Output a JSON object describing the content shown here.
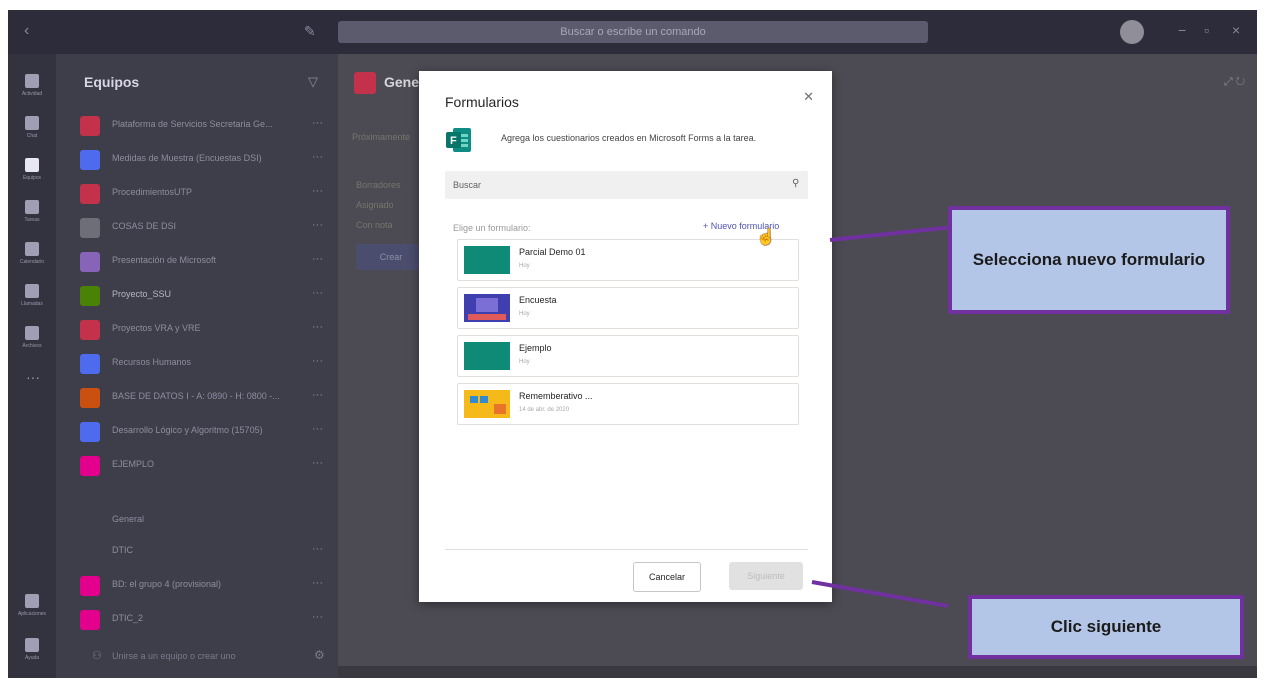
{
  "titlebar": {
    "search_placeholder": "Buscar o escribe un comando"
  },
  "rail": {
    "items": [
      {
        "label": "Actividad",
        "icon": "bell-icon"
      },
      {
        "label": "Chat",
        "icon": "chat-icon"
      },
      {
        "label": "Equipos",
        "icon": "teams-icon"
      },
      {
        "label": "Tareas",
        "icon": "assignments-icon"
      },
      {
        "label": "Calendario",
        "icon": "calendar-icon"
      },
      {
        "label": "Llamadas",
        "icon": "phone-icon"
      },
      {
        "label": "Archivos",
        "icon": "files-icon"
      }
    ],
    "bottom": [
      {
        "label": "Aplicaciones",
        "icon": "apps-icon"
      },
      {
        "label": "Ayuda",
        "icon": "help-icon"
      }
    ]
  },
  "teams_list": {
    "header": "Equipos",
    "teams": [
      {
        "name": "Plataforma de Servicios Secretaria Ge...",
        "color": "#c4314b"
      },
      {
        "name": "Medidas de Muestra (Encuestas DSI)",
        "color": "#4f6bed"
      },
      {
        "name": "ProcedimientosUTP",
        "color": "#c4314b"
      },
      {
        "name": "COSAS DE DSI",
        "color": "#6e6e78"
      },
      {
        "name": "Presentación de Microsoft",
        "color": "#8764b8"
      },
      {
        "name": "Proyecto_SSU",
        "color": "#498205"
      },
      {
        "name": "Proyectos VRA y VRE",
        "color": "#c4314b"
      },
      {
        "name": "Recursos Humanos",
        "color": "#4f6bed"
      },
      {
        "name": "BASE DE DATOS I - A: 0890 - H: 0800 -...",
        "color": "#ca5010"
      },
      {
        "name": "Desarrollo Lógico y Algoritmo (15705)",
        "color": "#4f6bed"
      },
      {
        "name": "EJEMPLO",
        "color": "#e3008c"
      },
      {
        "name": "DTIC",
        "color": ""
      },
      {
        "name": "BD: el grupo 4 (provisional)",
        "color": "#e3008c"
      },
      {
        "name": "DTIC_2",
        "color": "#e3008c"
      }
    ],
    "channel": "General",
    "join_label": "Unirse a un equipo o crear uno"
  },
  "main": {
    "channel_title": "General",
    "tab_label": "Próximamente",
    "assignment_sections": [
      "Borradores",
      "Asignado",
      "Con nota"
    ],
    "create_button": "Crear"
  },
  "modal": {
    "title": "Formularios",
    "description": "Agrega los cuestionarios creados en Microsoft Forms a la tarea.",
    "search_placeholder": "Buscar",
    "choose_label": "Elige un formulario:",
    "new_form_label": "+ Nuevo formulario",
    "forms": [
      {
        "name": "Parcial Demo 01",
        "date": "Hoy"
      },
      {
        "name": "Encuesta",
        "date": "Hoy"
      },
      {
        "name": "Ejemplo",
        "date": "Hoy"
      },
      {
        "name": "Rememberativo ...",
        "date": "14 de abr. de 2020"
      }
    ],
    "cancel_label": "Cancelar",
    "next_label": "Siguiente"
  },
  "annotations": {
    "callout_1": "Selecciona nuevo formulario",
    "callout_2": "Clic siguiente"
  },
  "colors": {
    "accent": "#4f52b2",
    "callout_fill": "#b4c6e7",
    "callout_border": "#7030a0"
  }
}
